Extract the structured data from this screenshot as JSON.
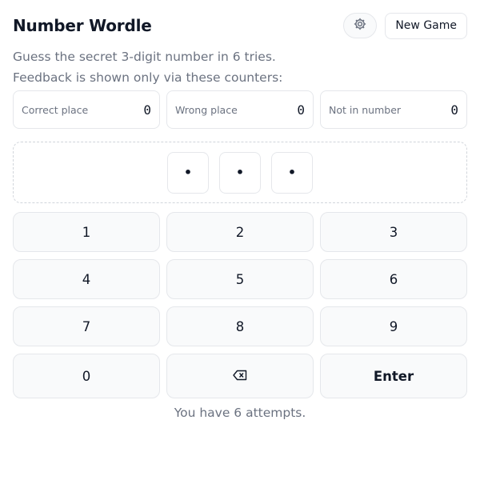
{
  "header": {
    "title": "Number Wordle",
    "settings_icon": "gear-icon",
    "new_game_label": "New Game"
  },
  "description": {
    "line1": "Guess the secret 3-digit number in 6 tries.",
    "line2": "Feedback is shown only via these counters:"
  },
  "counters": [
    {
      "label": "Correct place",
      "value": "0"
    },
    {
      "label": "Wrong place",
      "value": "0"
    },
    {
      "label": "Not in number",
      "value": "0"
    }
  ],
  "board": {
    "cells": [
      "•",
      "•",
      "•"
    ]
  },
  "keypad": {
    "keys": [
      {
        "label": "1"
      },
      {
        "label": "2"
      },
      {
        "label": "3"
      },
      {
        "label": "4"
      },
      {
        "label": "5"
      },
      {
        "label": "6"
      },
      {
        "label": "7"
      },
      {
        "label": "8"
      },
      {
        "label": "9"
      },
      {
        "label": "0"
      },
      {
        "label": "",
        "icon": "backspace-icon"
      },
      {
        "label": "Enter"
      }
    ]
  },
  "status": "You have 6 attempts."
}
